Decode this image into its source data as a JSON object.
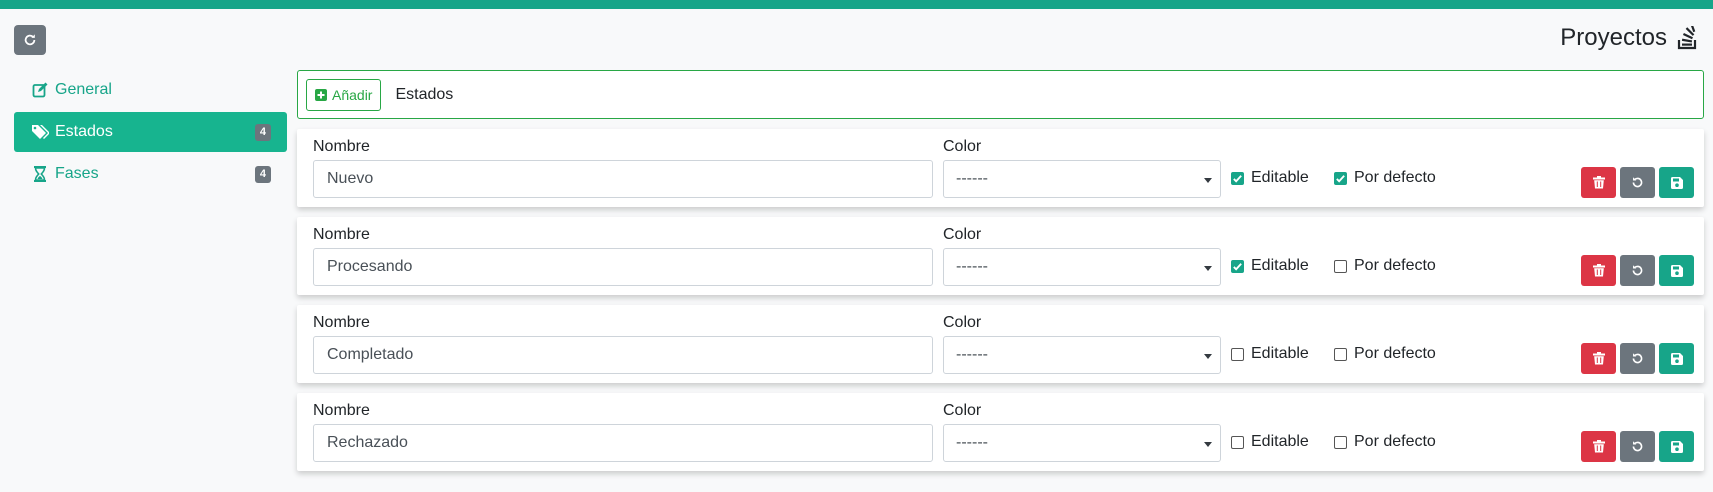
{
  "header": {
    "page_title": "Proyectos",
    "accent_color": "#17a589"
  },
  "sidebar": {
    "items": [
      {
        "label": "General",
        "icon": "edit-icon",
        "badge": ""
      },
      {
        "label": "Estados",
        "icon": "tags-icon",
        "badge": "4"
      },
      {
        "label": "Fases",
        "icon": "hourglass-icon",
        "badge": "4"
      }
    ],
    "active": "Estados"
  },
  "toolbar": {
    "add_label": "Añadir",
    "title": "Estados"
  },
  "form_labels": {
    "name": "Nombre",
    "color": "Color",
    "editable": "Editable",
    "default": "Por defecto"
  },
  "states": [
    {
      "name": "Nuevo",
      "color": "------",
      "editable": true,
      "default": true
    },
    {
      "name": "Procesando",
      "color": "------",
      "editable": true,
      "default": false
    },
    {
      "name": "Completado",
      "color": "------",
      "editable": false,
      "default": false
    },
    {
      "name": "Rechazado",
      "color": "------",
      "editable": false,
      "default": false
    }
  ],
  "colors": {
    "delete": "#dc3545",
    "reset": "#6c757d",
    "save": "#17a589"
  }
}
